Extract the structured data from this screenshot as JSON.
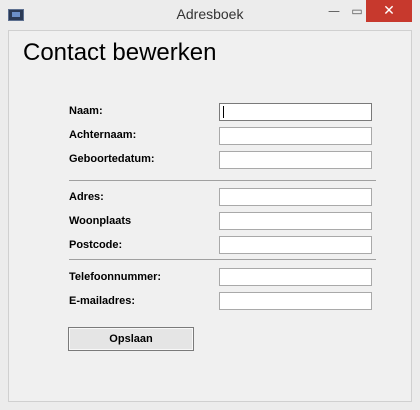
{
  "window": {
    "title": "Adresboek",
    "minimize_glyph": "—",
    "maximize_glyph": "▭",
    "close_glyph": "✕"
  },
  "form": {
    "heading": "Contact bewerken",
    "fields": {
      "naam": {
        "label": "Naam:",
        "value": ""
      },
      "achternaam": {
        "label": "Achternaam:",
        "value": ""
      },
      "geboortedatum": {
        "label": "Geboortedatum:",
        "value": ""
      },
      "adres": {
        "label": "Adres:",
        "value": ""
      },
      "woonplaats": {
        "label": "Woonplaats",
        "value": ""
      },
      "postcode": {
        "label": "Postcode:",
        "value": ""
      },
      "telefoonnummer": {
        "label": "Telefoonnummer:",
        "value": ""
      },
      "emailadres": {
        "label": "E-mailadres:",
        "value": ""
      }
    },
    "save_label": "Opslaan"
  },
  "colors": {
    "close_button": "#c7392d",
    "client_background": "#f0f0f0"
  }
}
